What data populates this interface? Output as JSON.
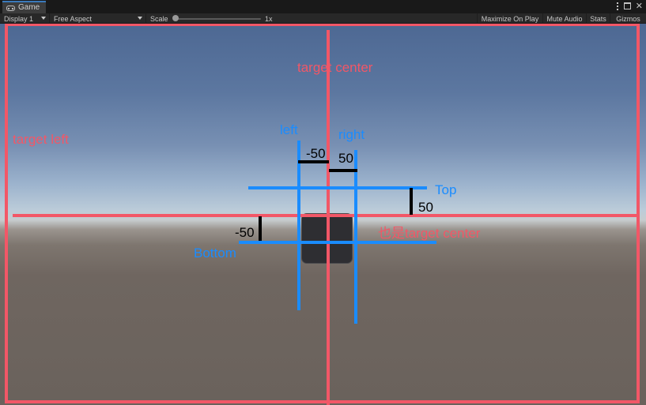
{
  "window": {
    "tab_label": "Game"
  },
  "toolbar": {
    "display": "Display 1",
    "aspect": "Free Aspect",
    "scale_label": "Scale",
    "scale_value": "1x",
    "maximize_on_play": "Maximize On Play",
    "mute_audio": "Mute Audio",
    "stats": "Stats",
    "gizmos": "Gizmos"
  },
  "annotations": {
    "target_center": "target center",
    "target_left": "target left",
    "left": "left",
    "right": "right",
    "top": "Top",
    "bottom": "Bottom",
    "left_value": "-50",
    "right_value": "50",
    "top_value": "50",
    "bottom_value": "-50",
    "also_target_center": "也是target center"
  },
  "colors": {
    "target_red": "#f25767",
    "anchor_blue": "#1a8cff",
    "offset_black": "#000000"
  }
}
